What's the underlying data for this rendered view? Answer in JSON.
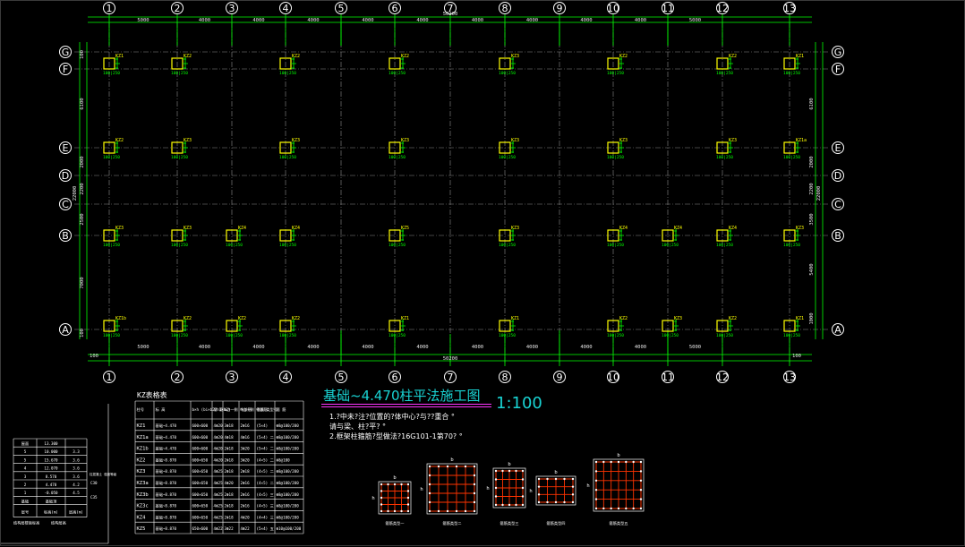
{
  "drawing": {
    "title": "基础~4.470柱平法施工图",
    "scale": "1:100",
    "notes": [
      "1.?中未?注?位置的?体中心?与??重合 °",
      "  请与梁、柱?平? °",
      "2.框架柱箍筋?型做法?16G101-1第70? °"
    ],
    "colors": {
      "axis": "#ffffff",
      "dimension": "#00ff00",
      "column": "#ffff00",
      "title": "#19d3d3",
      "rebar": "#ff3300"
    }
  },
  "axes": {
    "columns": [
      "1",
      "2",
      "3",
      "4",
      "5",
      "6",
      "7",
      "8",
      "9",
      "10",
      "11",
      "12",
      "13"
    ],
    "rows": [
      "G",
      "F",
      "E",
      "D",
      "C",
      "B",
      "A"
    ],
    "top_spacings": [
      "5000",
      "4000",
      "4000",
      "4000",
      "4000",
      "4000",
      "4000",
      "4000",
      "4000",
      "4000",
      "5000"
    ],
    "top_total": "50200",
    "bottom_spacings": [
      "5000",
      "4000",
      "4000",
      "4000",
      "4000",
      "4000",
      "4000",
      "4000",
      "4000",
      "4000",
      "5000"
    ],
    "bottom_total": "50200",
    "edge_offset": "100",
    "left_dims": [
      "100",
      "6100",
      "2000",
      "2200",
      "2500",
      "7000",
      "100"
    ],
    "left_total": "22000",
    "right_dims": [
      "6100",
      "2000",
      "2200",
      "3500",
      "5400",
      "1000"
    ],
    "right_total": "22000"
  },
  "columns_row_G": [
    "KZ1",
    "KZ2",
    "KZ2",
    "KZ2",
    "KZ3",
    "KZ2",
    "KZ2",
    "KZ1"
  ],
  "columns_row_E": [
    "KZ2",
    "KZ3",
    "KZ3",
    "KZ3",
    "KZ3",
    "KZ3",
    "KZ3",
    "KZ1a"
  ],
  "columns_row_B": [
    "KZ3",
    "KZ3",
    "KZ4",
    "KZ4",
    "KZ5",
    "KZ3",
    "KZ4",
    "KZ4",
    "KZ4",
    "KZ3"
  ],
  "columns_row_A": [
    "KZ1b",
    "KZ2",
    "KZ2",
    "KZ2",
    "KZ1",
    "KZ1",
    "KZ2",
    "KZ3",
    "KZ2",
    "KZ1"
  ],
  "column_size_label": "100|250",
  "kz_table": {
    "title": "KZ表格表",
    "headers": [
      "柱号",
      "标 高",
      "b×h (bi×b2/h1×h2)",
      "角 筋",
      "b边一侧 中部筋",
      "h边一侧 中部筋",
      "箍筋 类型号",
      "箍 筋"
    ],
    "rows": [
      [
        "KZ1",
        "基础~4.470",
        "600×600",
        "4Φ20",
        "3Φ18",
        "2Φ16",
        "(5×4)",
        "Φ8@100/200"
      ],
      [
        "KZ1a",
        "基础~4.470",
        "600×600",
        "4Φ20",
        "4Φ18",
        "4Φ16",
        "(5×4) 二",
        "Φ8@100/200"
      ],
      [
        "KZ1b",
        "基础~4.470",
        "600×600",
        "4Φ20",
        "2Φ18",
        "3Φ20",
        "(5×4) 二",
        "Φ8@100/200"
      ],
      [
        "KZ2",
        "基础~8.870",
        "600×650",
        "4Φ20",
        "2Φ18",
        "3Φ20",
        "(4×5) 二",
        "Φ8@100"
      ],
      [
        "KZ3",
        "基础~8.870",
        "600×650",
        "4Φ25",
        "2Φ18",
        "2Φ18",
        "(4×5) 二",
        "Φ8@100/200"
      ],
      [
        "KZ3a",
        "基础~8.870",
        "600×650",
        "4Φ25",
        "4Φ20",
        "2Φ16",
        "(4×5) 二",
        "Φ8@100/200"
      ],
      [
        "KZ3b",
        "基础~8.870",
        "600×650",
        "4Φ25",
        "2Φ18",
        "2Φ16",
        "(4×5) 三",
        "Φ8@100/200"
      ],
      [
        "KZ3c",
        "基础~8.870",
        "600×650",
        "4Φ25",
        "2Φ18",
        "2Φ16",
        "(4×5) 三",
        "Φ8@100/200"
      ],
      [
        "KZ4",
        "基础~8.870",
        "600×650",
        "4Φ25",
        "2Φ18",
        "4Φ20",
        "(4×4) 三",
        "Φ8@100/200"
      ],
      [
        "KZ5",
        "基础~8.870",
        "650×600",
        "4Φ22",
        "3Φ22",
        "4Φ22",
        "(5×4) 五",
        "Φ10@100/200"
      ]
    ]
  },
  "level_table": {
    "headers": [
      "层号",
      "标高(m)",
      "层高(m)"
    ],
    "rows": [
      [
        "屋面",
        "13.300",
        ""
      ],
      [
        "5",
        "10.000",
        "3.3"
      ],
      [
        "5",
        "15.670",
        "3.6"
      ],
      [
        "4",
        "12.070",
        "3.6"
      ],
      [
        "3",
        "8.570",
        "3.6"
      ],
      [
        "2",
        "4.470",
        "4.2"
      ],
      [
        "1",
        "-0.050",
        "4.5"
      ],
      [
        "基础",
        "基础顶",
        ""
      ]
    ],
    "footer_labels": [
      "层号",
      "标高(m)",
      "层高(m)"
    ],
    "grade_labels": [
      "C30",
      "C35"
    ],
    "grade_caption": "结构层楼面标高",
    "grade_caption2": "结构层高",
    "side_note": "柱混凝土 强度等级"
  },
  "section_types": {
    "dim_b": "b",
    "dim_h": "h",
    "labels": [
      "箍筋类型一",
      "箍筋类型二",
      "箍筋类型三",
      "箍筋类型四",
      "箍筋类型五"
    ]
  }
}
